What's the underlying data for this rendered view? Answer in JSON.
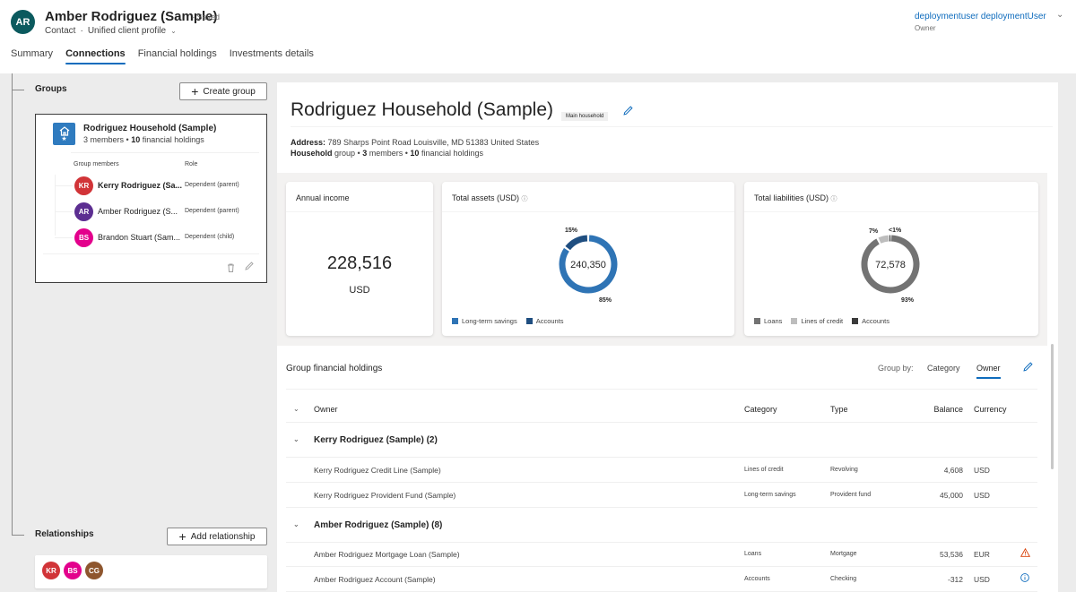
{
  "header": {
    "avatar_initials": "AR",
    "record_name": "Amber Rodriguez (Sample)",
    "save_status": "- Saved",
    "entity_type": "Contact",
    "separator": "·",
    "form_name": "Unified client profile",
    "user_name": "deploymentuser deploymentUser",
    "user_role": "Owner"
  },
  "tabs": [
    {
      "label": "Summary",
      "active": false
    },
    {
      "label": "Connections",
      "active": true
    },
    {
      "label": "Financial holdings",
      "active": false
    },
    {
      "label": "Investments details",
      "active": false
    }
  ],
  "groups_panel": {
    "title": "Groups",
    "create_button": "Create group",
    "group": {
      "name": "Rodriguez Household (Sample)",
      "members_count": "3",
      "members_label": "members •",
      "holdings_count": "10",
      "holdings_label": "financial holdings",
      "col_members": "Group members",
      "col_role": "Role",
      "members": [
        {
          "initials": "KR",
          "name": "Kerry Rodriguez (Sa...",
          "role": "Dependent (parent)",
          "color": "#d13438",
          "bold": true
        },
        {
          "initials": "AR",
          "name": "Amber Rodriguez (S...",
          "role": "Dependent (parent)",
          "color": "#5c2e91",
          "bold": false
        },
        {
          "initials": "BS",
          "name": "Brandon Stuart (Sam...",
          "role": "Dependent (child)",
          "color": "#e3008c",
          "bold": false
        }
      ]
    }
  },
  "relationships_panel": {
    "title": "Relationships",
    "add_button": "Add relationship",
    "avatars": [
      {
        "initials": "KR",
        "color": "#d13438"
      },
      {
        "initials": "BS",
        "color": "#e3008c"
      },
      {
        "initials": "CG",
        "color": "#8e562e"
      }
    ]
  },
  "household": {
    "title": "Rodriguez Household (Sample)",
    "badge": "Main household",
    "address_label": "Address:",
    "address": "789 Sharps Point Road Louisville, MD 51383 United States",
    "group_type": "Household",
    "group_line_rest_1": "group •",
    "members": "3",
    "group_line_rest_2": "members •",
    "holdings": "10",
    "group_line_rest_3": "financial holdings"
  },
  "kpis": {
    "income": {
      "title": "Annual income",
      "value": "228,516",
      "unit": "USD"
    }
  },
  "chart_data": [
    {
      "type": "pie",
      "title": "Total assets (USD)",
      "center_label": "240,350",
      "categories": [
        "Long-term savings",
        "Accounts"
      ],
      "values": [
        85,
        15
      ],
      "value_labels": [
        "85%",
        "15%"
      ],
      "colors": [
        "#2f74b5",
        "#1f4e80"
      ],
      "legend": "bottom-left"
    },
    {
      "type": "pie",
      "title": "Total liabilities (USD)",
      "center_label": "72,578",
      "categories": [
        "Loans",
        "Lines of credit",
        "Accounts"
      ],
      "values": [
        92.6,
        6.9,
        0.5
      ],
      "value_labels": [
        "93%",
        "7%",
        "<1%"
      ],
      "colors": [
        "#737373",
        "#bdbdbd",
        "#3b3b3b"
      ],
      "legend": "bottom-left"
    }
  ],
  "holdings": {
    "title": "Group financial holdings",
    "group_by_label": "Group by:",
    "group_by_options": [
      "Category",
      "Owner"
    ],
    "group_by_selected": "Owner",
    "columns": {
      "owner": "Owner",
      "category": "Category",
      "type": "Type",
      "balance": "Balance",
      "currency": "Currency"
    },
    "groups": [
      {
        "label": "Kerry Rodriguez (Sample) (2)",
        "rows": [
          {
            "name": "Kerry Rodriguez Credit Line (Sample)",
            "category": "Lines of credit",
            "type": "Revolving",
            "balance": "4,608",
            "currency": "USD",
            "flag": ""
          },
          {
            "name": "Kerry Rodriguez Provident Fund (Sample)",
            "category": "Long-term savings",
            "type": "Provident fund",
            "balance": "45,000",
            "currency": "USD",
            "flag": ""
          }
        ]
      },
      {
        "label": "Amber Rodriguez (Sample) (8)",
        "rows": [
          {
            "name": "Amber Rodriguez Mortgage Loan (Sample)",
            "category": "Loans",
            "type": "Mortgage",
            "balance": "53,536",
            "currency": "EUR",
            "flag": "warning"
          },
          {
            "name": "Amber Rodriguez Account (Sample)",
            "category": "Accounts",
            "type": "Checking",
            "balance": "-312",
            "currency": "USD",
            "flag": "info"
          }
        ]
      }
    ]
  },
  "colors": {
    "accent": "#0f6cbd",
    "warning": "#d83b01",
    "info": "#0f6cbd"
  }
}
